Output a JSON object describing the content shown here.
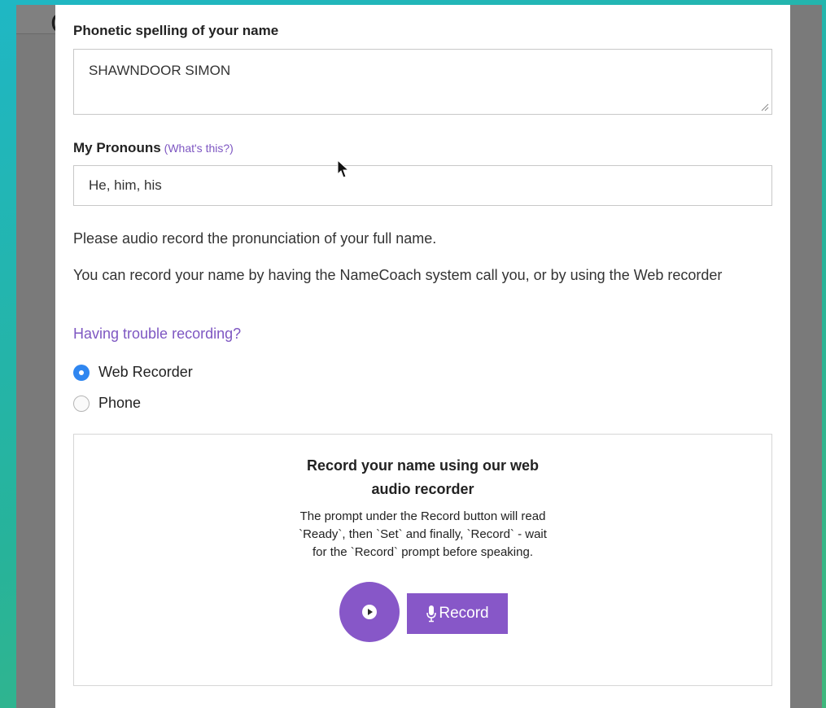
{
  "background_page": {
    "letter": "C"
  },
  "form": {
    "phonetic": {
      "label": "Phonetic spelling of your name",
      "value": "SHAWNDOOR SIMON"
    },
    "pronouns": {
      "label": "My Pronouns",
      "help_link": "(What's this?)",
      "value": "He, him, his"
    },
    "instructions": {
      "line1": "Please audio record the pronunciation of your full name.",
      "line2": "You can record your name by having the NameCoach system call you, or by using the Web recorder"
    },
    "trouble_link": "Having trouble recording?",
    "methods": [
      {
        "label": "Web Recorder",
        "selected": true
      },
      {
        "label": "Phone",
        "selected": false
      }
    ]
  },
  "recorder": {
    "title_line1": "Record your name using our web",
    "title_line2": "audio recorder",
    "desc_line1": "The prompt under the Record button will read",
    "desc_line2": "`Ready`, then `Set` and finally, `Record` - wait",
    "desc_line3": "for the `Record` prompt before speaking.",
    "record_label": "Record",
    "play_icon": "play-icon",
    "mic_icon": "microphone-icon"
  },
  "colors": {
    "accent": "#8757c8",
    "link": "#7e57c2",
    "radio_selected": "#2f86f0"
  }
}
